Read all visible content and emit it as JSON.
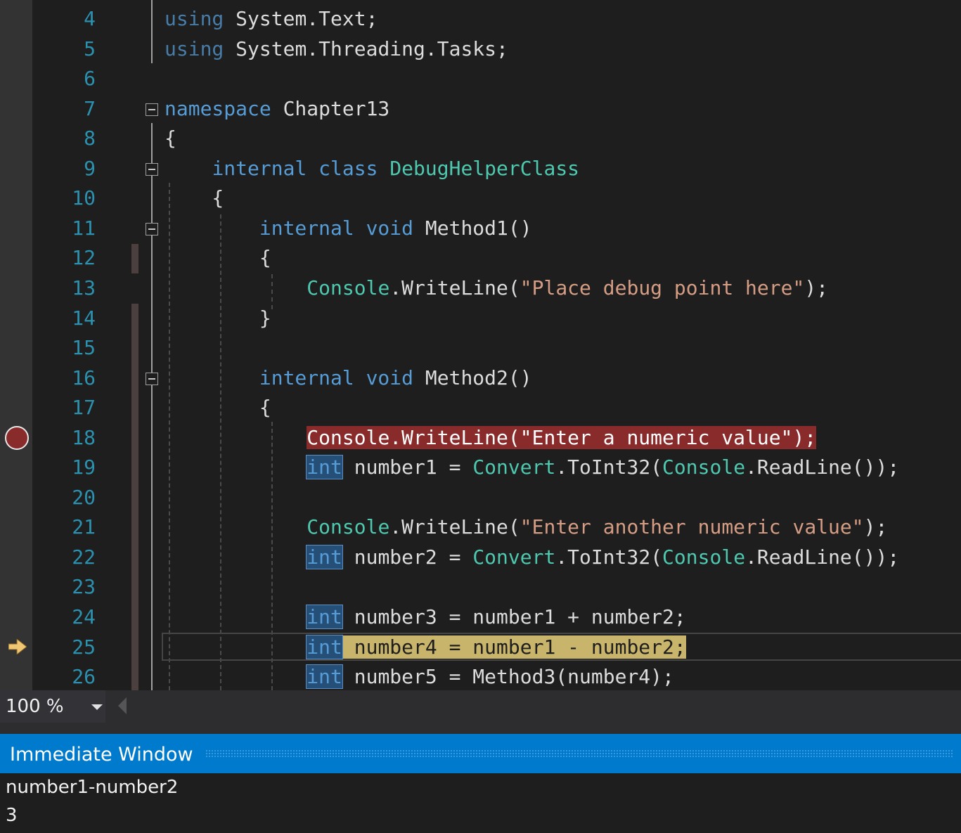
{
  "editor": {
    "lines": [
      {
        "no": "4",
        "tokens": [
          [
            "kw dim",
            "using"
          ],
          [
            "ns",
            " System.Text;"
          ]
        ]
      },
      {
        "no": "5",
        "tokens": [
          [
            "kw dim",
            "using"
          ],
          [
            "ns",
            " System.Threading.Tasks;"
          ]
        ]
      },
      {
        "no": "6",
        "tokens": []
      },
      {
        "no": "7",
        "tokens": [
          [
            "kw",
            "namespace"
          ],
          [
            "ns",
            " Chapter13"
          ]
        ]
      },
      {
        "no": "8",
        "tokens": [
          [
            "ns",
            "{"
          ]
        ]
      },
      {
        "no": "9",
        "tokens": [
          [
            "ns",
            "    "
          ],
          [
            "kw",
            "internal"
          ],
          [
            "ns",
            " "
          ],
          [
            "kw",
            "class"
          ],
          [
            "ns",
            " "
          ],
          [
            "ty",
            "DebugHelperClass"
          ]
        ]
      },
      {
        "no": "10",
        "tokens": [
          [
            "ns",
            "    {"
          ]
        ]
      },
      {
        "no": "11",
        "tokens": [
          [
            "ns",
            "        "
          ],
          [
            "kw",
            "internal"
          ],
          [
            "ns",
            " "
          ],
          [
            "kw",
            "void"
          ],
          [
            "ns",
            " Method1()"
          ]
        ]
      },
      {
        "no": "12",
        "tokens": [
          [
            "ns",
            "        {"
          ]
        ]
      },
      {
        "no": "13",
        "tokens": [
          [
            "ns",
            "            "
          ],
          [
            "ty",
            "Console"
          ],
          [
            "ns",
            ".WriteLine("
          ],
          [
            "str",
            "\"Place debug point here\""
          ],
          [
            "ns",
            ");"
          ]
        ]
      },
      {
        "no": "14",
        "tokens": [
          [
            "ns",
            "        }"
          ]
        ]
      },
      {
        "no": "15",
        "tokens": []
      },
      {
        "no": "16",
        "tokens": [
          [
            "ns",
            "        "
          ],
          [
            "kw",
            "internal"
          ],
          [
            "ns",
            " "
          ],
          [
            "kw",
            "void"
          ],
          [
            "ns",
            " Method2()"
          ]
        ]
      },
      {
        "no": "17",
        "tokens": [
          [
            "ns",
            "        {"
          ]
        ]
      },
      {
        "no": "18",
        "tokens": [
          [
            "ns",
            "            "
          ],
          [
            "bp",
            "Console.WriteLine(\"Enter a numeric value\");"
          ]
        ]
      },
      {
        "no": "19",
        "tokens": [
          [
            "ns",
            "            "
          ],
          [
            "intbox",
            "int"
          ],
          [
            "ns",
            " number1 = "
          ],
          [
            "ty",
            "Convert"
          ],
          [
            "ns",
            ".ToInt32("
          ],
          [
            "ty",
            "Console"
          ],
          [
            "ns",
            ".ReadLine());"
          ]
        ]
      },
      {
        "no": "20",
        "tokens": []
      },
      {
        "no": "21",
        "tokens": [
          [
            "ns",
            "            "
          ],
          [
            "ty",
            "Console"
          ],
          [
            "ns",
            ".WriteLine("
          ],
          [
            "str",
            "\"Enter another numeric value\""
          ],
          [
            "ns",
            ");"
          ]
        ]
      },
      {
        "no": "22",
        "tokens": [
          [
            "ns",
            "            "
          ],
          [
            "intbox",
            "int"
          ],
          [
            "ns",
            " number2 = "
          ],
          [
            "ty",
            "Convert"
          ],
          [
            "ns",
            ".ToInt32("
          ],
          [
            "ty",
            "Console"
          ],
          [
            "ns",
            ".ReadLine());"
          ]
        ]
      },
      {
        "no": "23",
        "tokens": []
      },
      {
        "no": "24",
        "tokens": [
          [
            "ns",
            "            "
          ],
          [
            "intbox",
            "int"
          ],
          [
            "ns",
            " number3 = number1 + number2;"
          ]
        ]
      },
      {
        "no": "25",
        "tokens": [
          [
            "ns",
            "            "
          ],
          [
            "intbox exec",
            "int"
          ],
          [
            "exec",
            " number4 = number1 - number2;"
          ]
        ]
      },
      {
        "no": "26",
        "tokens": [
          [
            "ns",
            "            "
          ],
          [
            "intbox",
            "int"
          ],
          [
            "ns",
            " number5 = Method3(number4);"
          ]
        ]
      }
    ],
    "breakpoint_line": "18",
    "current_line": "25"
  },
  "status": {
    "zoom": "100 %"
  },
  "immediate": {
    "title": "Immediate Window",
    "lines": [
      "number1-number2",
      "3"
    ]
  },
  "colors": {
    "accent": "#007acc",
    "breakpoint": "#8a2b2b",
    "current_statement": "#c8b46a",
    "keyword": "#569cd6",
    "type": "#4ec9b0",
    "string": "#d69d85",
    "line_number": "#2b91af"
  }
}
